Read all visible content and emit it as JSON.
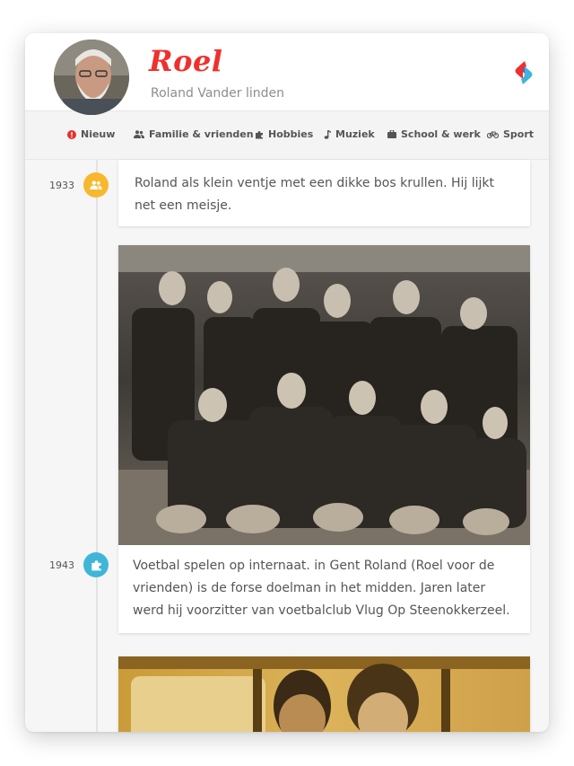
{
  "profile": {
    "name": "Roel",
    "full_name": "Roland Vander linden"
  },
  "nav": {
    "items": [
      {
        "label": "Nieuw",
        "icon": "alert-icon"
      },
      {
        "label": "Familie & vrienden",
        "icon": "people-icon"
      },
      {
        "label": "Hobbies",
        "icon": "puzzle-icon"
      },
      {
        "label": "Muziek",
        "icon": "music-note-icon"
      },
      {
        "label": "School & werk",
        "icon": "briefcase-icon"
      },
      {
        "label": "Sport",
        "icon": "bicycle-icon"
      }
    ]
  },
  "timeline": {
    "entries": [
      {
        "year": "1933",
        "icon": "people-icon",
        "text": "Roland als klein ventje met een dikke bos krullen. Hij lijkt net een meisje."
      },
      {
        "year": "1943",
        "icon": "puzzle-icon",
        "text": "Voetbal spelen op internaat. in Gent Roland (Roel voor de vrienden) is de forse doelman in het midden. Jaren later werd hij voorzitter van voetbalclub Vlug Op Steenokkerzeel."
      }
    ]
  },
  "colors": {
    "accent_red": "#f0302c",
    "people_dot": "#f7b82e",
    "puzzle_dot": "#3fb6d8",
    "alert_red": "#e8302b"
  }
}
